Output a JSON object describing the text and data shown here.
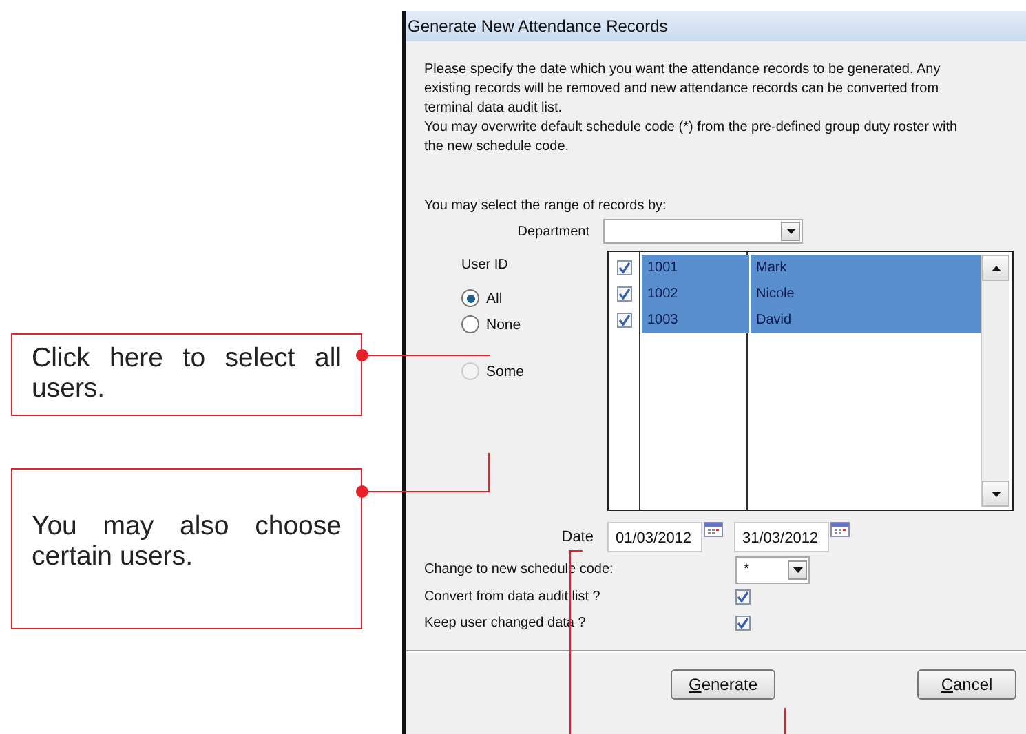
{
  "callouts": [
    {
      "text": "Click here to select all users."
    },
    {
      "text": "You may also choose certain users."
    }
  ],
  "dialog": {
    "title": "Generate New Attendance Records",
    "intro": [
      "Please specify the date which you want the attendance records to be generated. Any existing records will be removed and new attendance records can be converted from terminal data audit list.",
      "You may overwrite default schedule code (*) from the pre-defined group duty roster with the new schedule code."
    ],
    "range_label": "You may select the range of records by:",
    "department": {
      "label": "Department"
    },
    "user_id": {
      "label": "User ID",
      "options": [
        {
          "label": "All",
          "selected": true,
          "disabled": false
        },
        {
          "label": "None",
          "selected": false,
          "disabled": false
        },
        {
          "label": "Some",
          "selected": false,
          "disabled": true
        }
      ]
    },
    "users": [
      {
        "id": "1001",
        "name": "Mark",
        "checked": true,
        "selected": true
      },
      {
        "id": "1002",
        "name": "Nicole",
        "checked": true,
        "selected": true
      },
      {
        "id": "1003",
        "name": "David",
        "checked": true,
        "selected": true
      }
    ],
    "date": {
      "label": "Date",
      "from": "01/03/2012",
      "to": "31/03/2012"
    },
    "schedule_code": {
      "label": "Change to new schedule code:",
      "value": "*"
    },
    "options": [
      {
        "label": "Convert from data audit list ?",
        "checked": true
      },
      {
        "label": "Keep user changed data ?",
        "checked": true
      }
    ],
    "buttons": [
      "Generate",
      "Cancel"
    ]
  }
}
